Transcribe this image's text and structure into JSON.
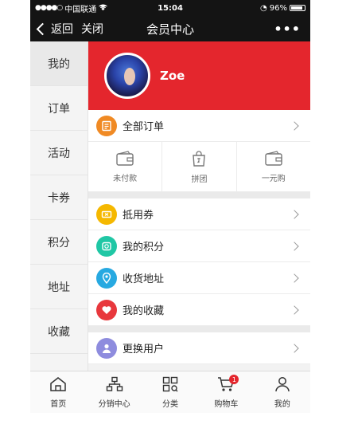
{
  "status_bar": {
    "carrier": "中国联通",
    "time": "15:04",
    "battery": "96%"
  },
  "nav": {
    "back_label": "返回",
    "close_label": "关闭",
    "title": "会员中心",
    "more_label": "•••"
  },
  "side_menu": [
    {
      "label": "我的"
    },
    {
      "label": "订单"
    },
    {
      "label": "活动"
    },
    {
      "label": "卡券"
    },
    {
      "label": "积分"
    },
    {
      "label": "地址"
    },
    {
      "label": "收藏"
    }
  ],
  "profile": {
    "name": "Zoe"
  },
  "all_orders": {
    "label": "全部订单"
  },
  "order_status": [
    {
      "label": "未付款",
      "icon": "wallet-icon"
    },
    {
      "label": "拼团",
      "icon": "shopping-bag-icon"
    },
    {
      "label": "一元购",
      "icon": "wallet-icon"
    }
  ],
  "list_items": [
    {
      "label": "抵用券",
      "icon": "coupon-icon",
      "color": "#f5b800"
    },
    {
      "label": "我的积分",
      "icon": "points-icon",
      "color": "#20c7a5"
    },
    {
      "label": "收货地址",
      "icon": "location-pin-icon",
      "color": "#27a9e1"
    },
    {
      "label": "我的收藏",
      "icon": "heart-icon",
      "color": "#e8383d"
    }
  ],
  "switch_user": {
    "label": "更换用户",
    "icon": "user-icon",
    "color": "#8e8cde"
  },
  "tabbar": [
    {
      "label": "首页",
      "icon": "home-icon"
    },
    {
      "label": "分销中心",
      "icon": "distribution-icon"
    },
    {
      "label": "分类",
      "icon": "category-icon"
    },
    {
      "label": "购物车",
      "icon": "cart-icon",
      "badge": "1"
    },
    {
      "label": "我的",
      "icon": "profile-icon"
    }
  ],
  "colors": {
    "brand_red": "#e4262d",
    "nav_bg": "#141414"
  }
}
